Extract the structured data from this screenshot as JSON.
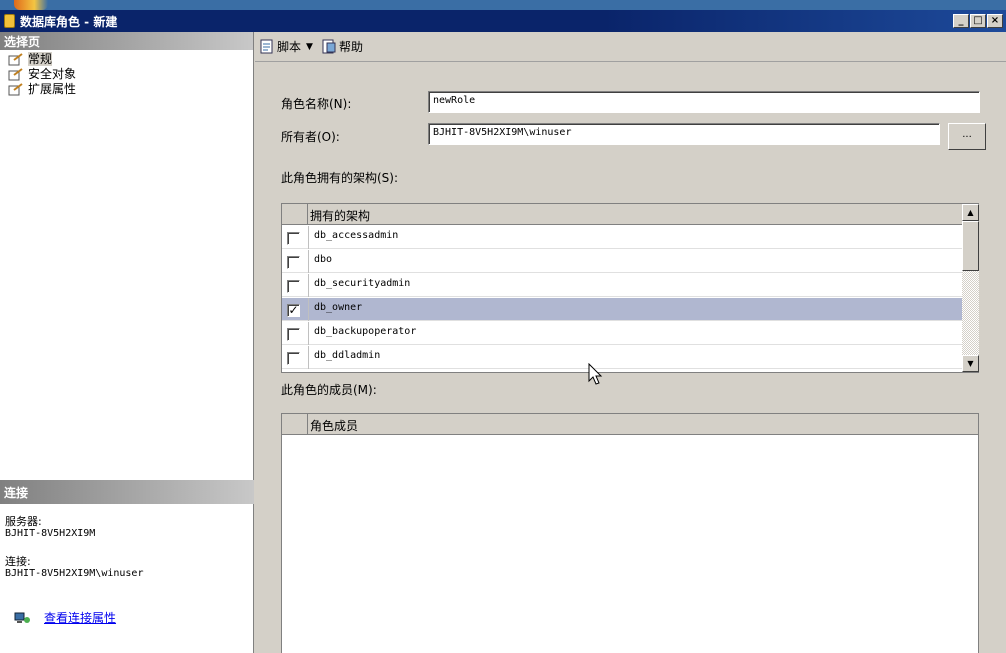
{
  "window": {
    "title": "数据库角色 - 新建",
    "controls": [
      "minimize",
      "maximize",
      "close"
    ]
  },
  "left_panel": {
    "select_page_header": "选择页",
    "pages": [
      {
        "label": "常规",
        "selected": true
      },
      {
        "label": "安全对象",
        "selected": false
      },
      {
        "label": "扩展属性",
        "selected": false
      }
    ],
    "connection_header": "连接",
    "server_label": "服务器:",
    "server_value": "BJHIT-8V5H2XI9M",
    "connection_label": "连接:",
    "connection_value": "BJHIT-8V5H2XI9M\\winuser",
    "view_connection_link": "查看连接属性"
  },
  "toolbar": {
    "script_label": "脚本",
    "help_label": "帮助"
  },
  "form": {
    "role_name_label": "角色名称(N):",
    "role_name_value": "newRole",
    "owner_label": "所有者(O):",
    "owner_value": "BJHIT-8V5H2XI9M\\winuser",
    "browse_label": "...",
    "owned_schemas_label": "此角色拥有的架构(S):",
    "schemas_column_header": "拥有的架构",
    "schemas": [
      {
        "name": "db_accessadmin",
        "checked": false,
        "selected": false
      },
      {
        "name": "dbo",
        "checked": false,
        "selected": false
      },
      {
        "name": "db_securityadmin",
        "checked": false,
        "selected": false
      },
      {
        "name": "db_owner",
        "checked": true,
        "selected": true
      },
      {
        "name": "db_backupoperator",
        "checked": false,
        "selected": false
      },
      {
        "name": "db_ddladmin",
        "checked": false,
        "selected": false
      }
    ],
    "members_label": "此角色的成员(M):",
    "members_column_header": "角色成员"
  },
  "colors": {
    "titlebar": "#0a246a",
    "selected_row": "#b0b7d0",
    "link": "#0000ee"
  }
}
